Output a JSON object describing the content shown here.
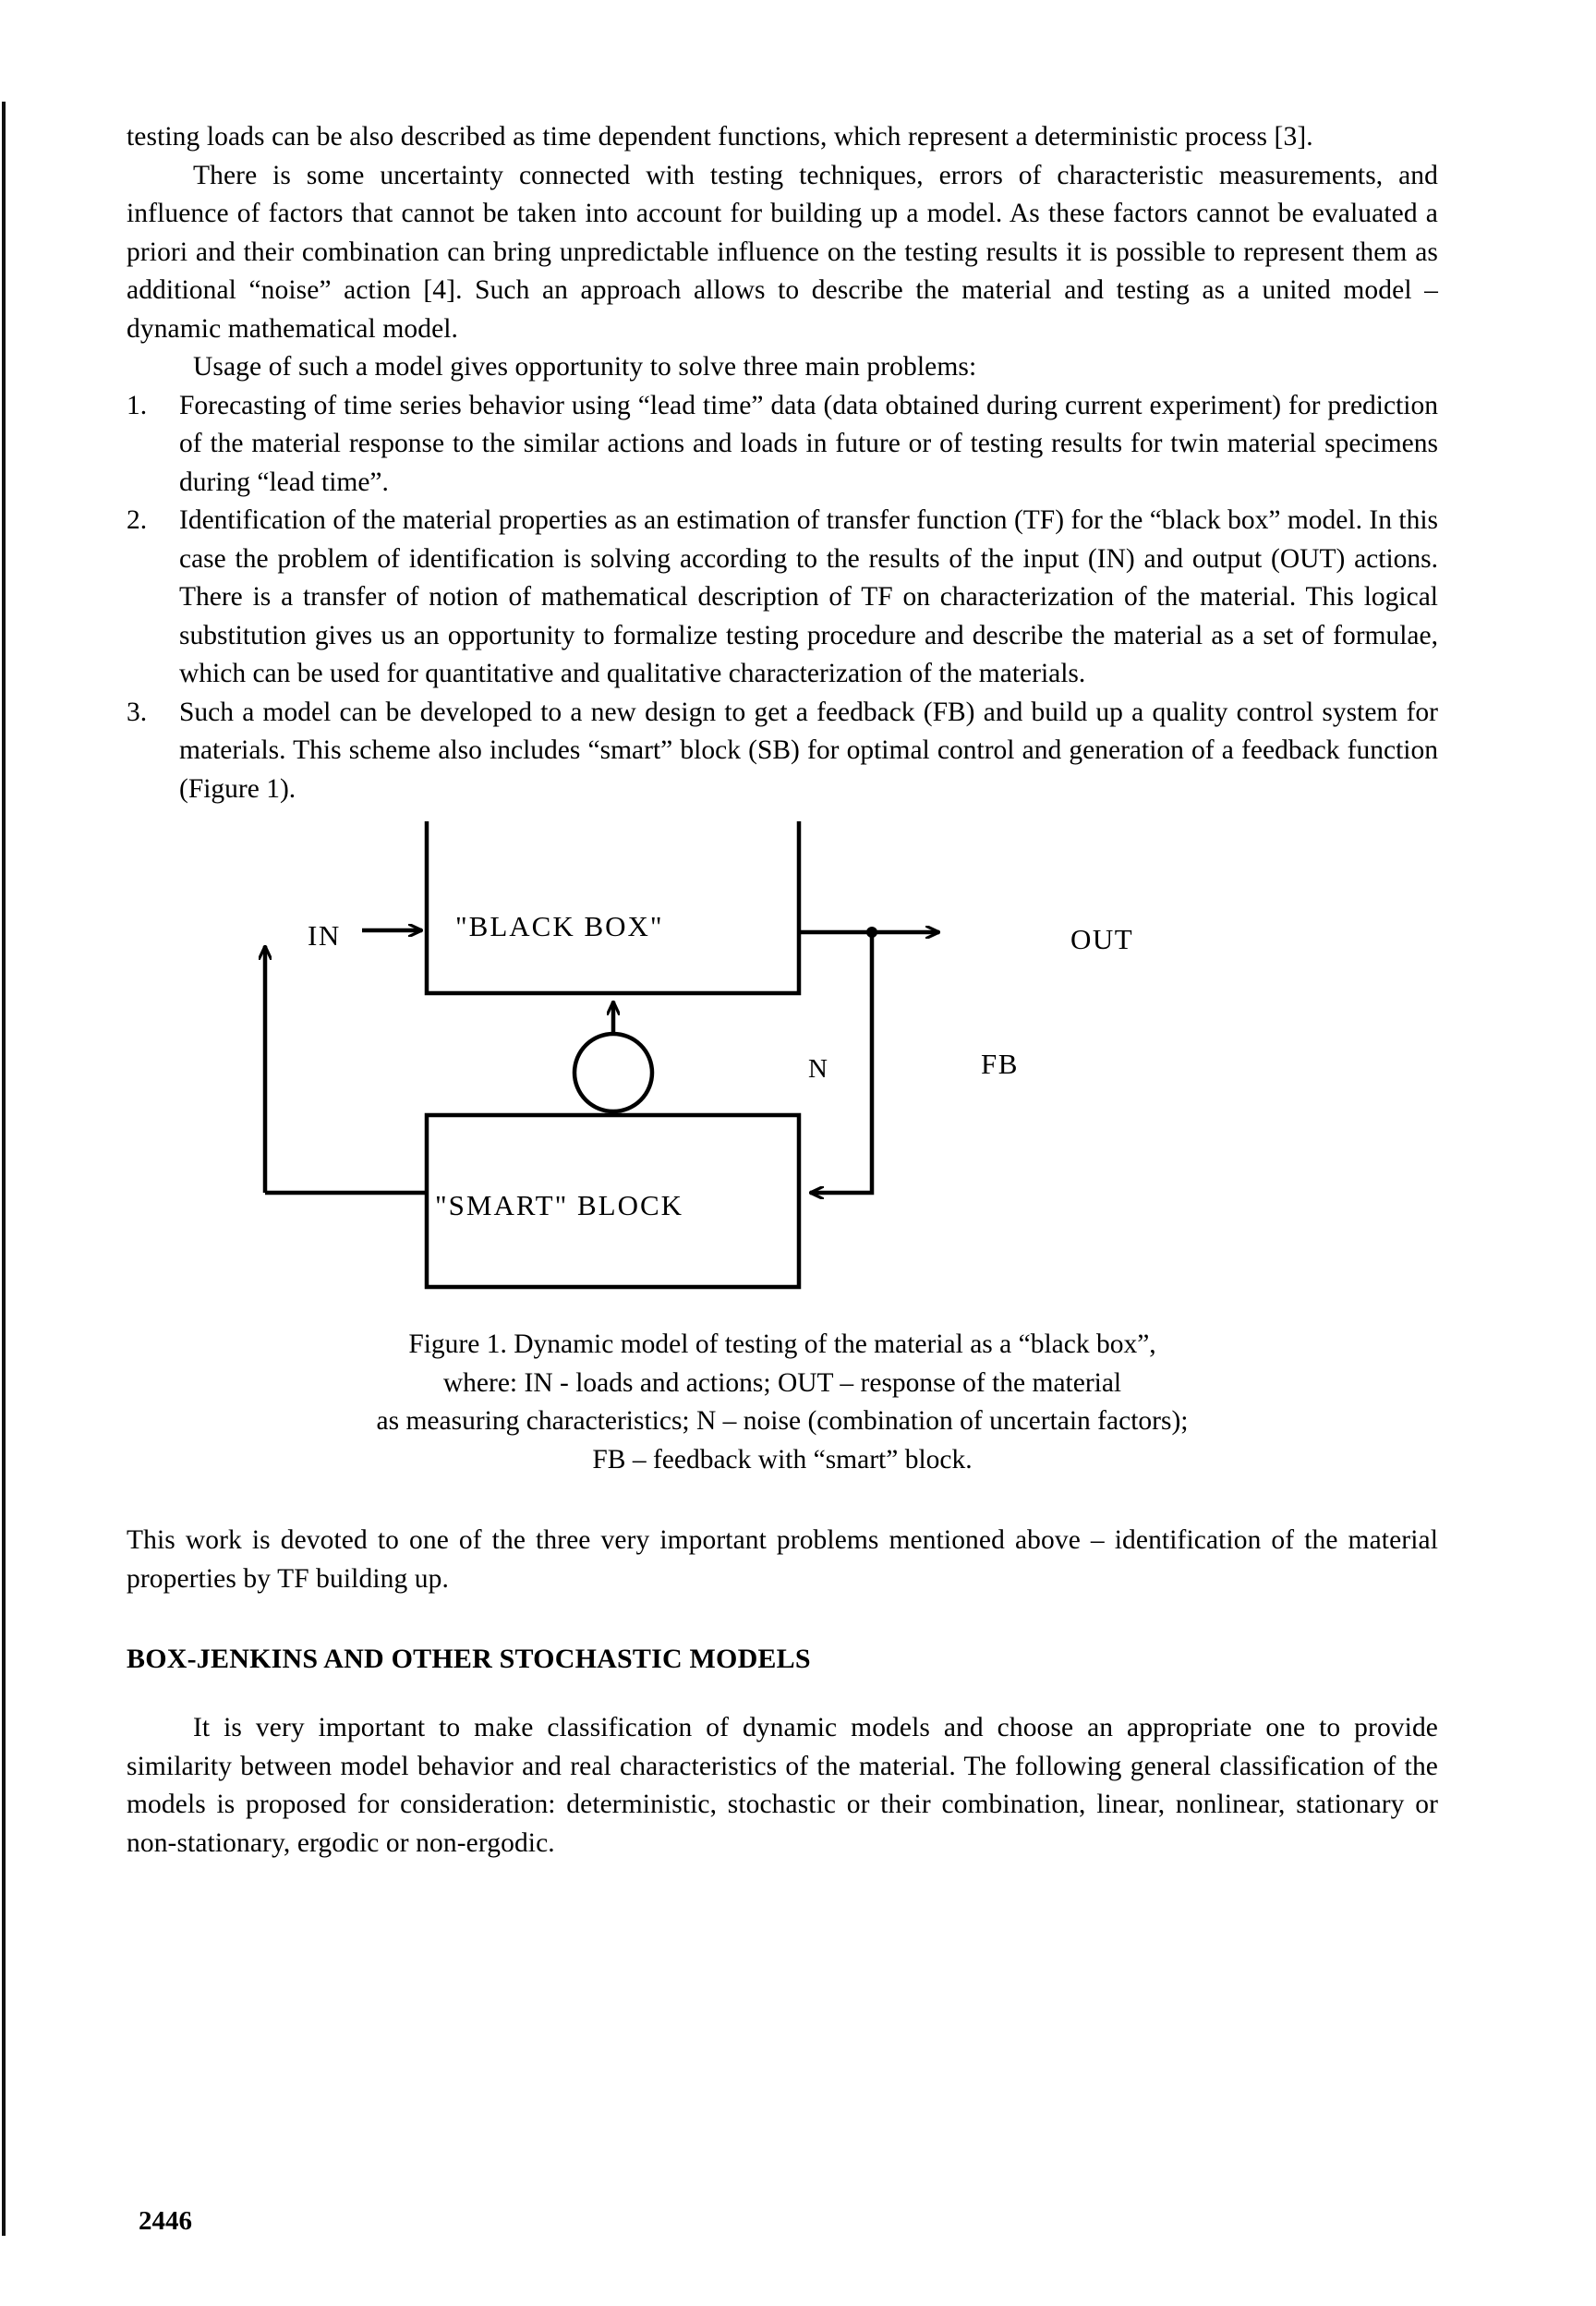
{
  "document": {
    "page_number": "2446",
    "paragraphs": {
      "p1": "testing loads can be also described as time dependent functions, which represent a deterministic process [3].",
      "p2": "There is some uncertainty connected with testing techniques, errors of characteristic measurements, and influence of factors that cannot be taken into account for building up a model. As these factors cannot be evaluated a priori and their combination can bring unpredictable influence on the testing results it is possible to represent them as additional “noise” action [4]. Such an approach allows to describe the material and testing as a united model – dynamic mathematical model.",
      "p3": "Usage of such a model gives opportunity to solve three main problems:",
      "p_after_figure": "This work is devoted to one of the three very important problems mentioned above – identification of the material properties by TF building up.",
      "p_last": "It is very important to make classification of dynamic models and choose an appropriate one to provide similarity between model behavior and real characteristics of the material. The following general classification of the models is proposed for consideration: deterministic, stochastic or their combination, linear, nonlinear, stationary or non-stationary, ergodic or non-ergodic."
    },
    "problems_list": [
      {
        "number": "1.",
        "text": "Forecasting of time series behavior using “lead time” data (data obtained during current experiment) for prediction of the material response to the similar actions and loads in future or of testing results for twin material specimens during “lead time”."
      },
      {
        "number": "2.",
        "text": "Identification of the material properties as an estimation of transfer function (TF) for the “black box” model. In this case the problem of identification is solving according to the results of the input (IN) and output (OUT) actions. There is a transfer of notion of mathematical description of TF on characterization of the material. This logical substitution gives us an opportunity to formalize testing procedure and describe the material as a set of formulae, which can be used for quantitative and qualitative characterization of the materials."
      },
      {
        "number": "3.",
        "text": "Such a model can be developed to a new design to get a feedback (FB) and build up a quality control system for materials. This scheme also includes “smart” block (SB) for optimal control and generation of a feedback function (Figure 1)."
      }
    ],
    "figure": {
      "labels": {
        "in": "IN",
        "out": "OUT",
        "fb": "FB",
        "black_box": "\"BLACK BOX\"",
        "smart_block": "\"SMART\" BLOCK",
        "noise": "N"
      },
      "caption_lines": [
        "Figure 1. Dynamic model of testing of the material as a “black box”,",
        "where: IN - loads and actions; OUT – response of the material",
        "as measuring characteristics; N – noise (combination of uncertain factors);",
        "FB – feedback with “smart” block."
      ]
    },
    "section_heading": "BOX-JENKINS AND OTHER STOCHASTIC MODELS"
  }
}
